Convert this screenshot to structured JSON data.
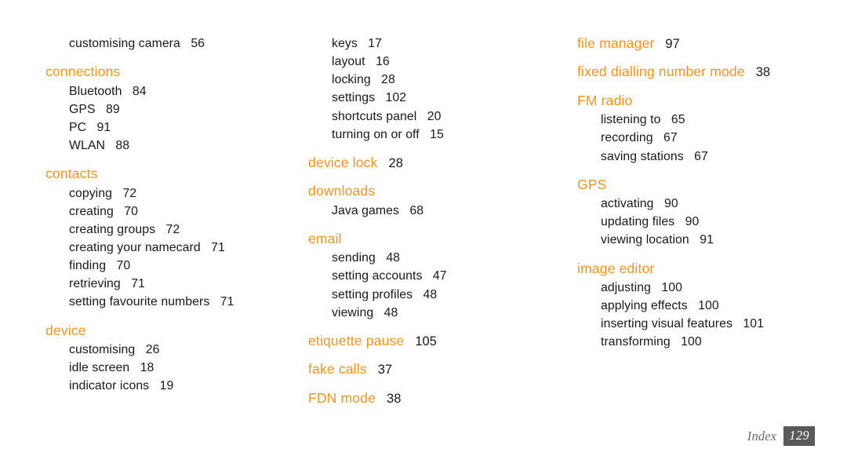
{
  "document": {
    "type": "index-page",
    "footer": {
      "label": "Index",
      "page_number": "129"
    },
    "colors": {
      "heading": "#F7941E",
      "body_text": "#181818",
      "page_number_badge_background": "#595959",
      "page_number_badge_text": "#FFFFFF",
      "footer_label": "#6B6B6B",
      "background": "#FFFFFF"
    }
  },
  "columns": [
    {
      "id": "column-1",
      "entries": [
        {
          "level": "sub",
          "label": "customising camera",
          "page": "56"
        },
        {
          "level": "head",
          "label": "connections",
          "page": ""
        },
        {
          "level": "sub",
          "label": "Bluetooth",
          "page": "84"
        },
        {
          "level": "sub",
          "label": "GPS",
          "page": "89"
        },
        {
          "level": "sub",
          "label": "PC",
          "page": "91"
        },
        {
          "level": "sub",
          "label": "WLAN",
          "page": "88"
        },
        {
          "level": "head",
          "label": "contacts",
          "page": ""
        },
        {
          "level": "sub",
          "label": "copying",
          "page": "72"
        },
        {
          "level": "sub",
          "label": "creating",
          "page": "70"
        },
        {
          "level": "sub",
          "label": "creating groups",
          "page": "72"
        },
        {
          "level": "sub",
          "label": "creating your namecard",
          "page": "71"
        },
        {
          "level": "sub",
          "label": "finding",
          "page": "70"
        },
        {
          "level": "sub",
          "label": "retrieving",
          "page": "71"
        },
        {
          "level": "sub",
          "label": "setting favourite numbers",
          "page": "71"
        },
        {
          "level": "head",
          "label": "device",
          "page": ""
        },
        {
          "level": "sub",
          "label": "customising",
          "page": "26"
        },
        {
          "level": "sub",
          "label": "idle screen",
          "page": "18"
        },
        {
          "level": "sub",
          "label": "indicator icons",
          "page": "19"
        }
      ]
    },
    {
      "id": "column-2",
      "entries": [
        {
          "level": "sub",
          "label": "keys",
          "page": "17"
        },
        {
          "level": "sub",
          "label": "layout",
          "page": "16"
        },
        {
          "level": "sub",
          "label": "locking",
          "page": "28"
        },
        {
          "level": "sub",
          "label": "settings",
          "page": "102"
        },
        {
          "level": "sub",
          "label": "shortcuts panel",
          "page": "20"
        },
        {
          "level": "sub",
          "label": "turning on or off",
          "page": "15"
        },
        {
          "level": "head",
          "label": "device lock",
          "page": "28"
        },
        {
          "level": "head",
          "label": "downloads",
          "page": ""
        },
        {
          "level": "sub",
          "label": "Java games",
          "page": "68"
        },
        {
          "level": "head",
          "label": "email",
          "page": ""
        },
        {
          "level": "sub",
          "label": "sending",
          "page": "48"
        },
        {
          "level": "sub",
          "label": "setting accounts",
          "page": "47"
        },
        {
          "level": "sub",
          "label": "setting profiles",
          "page": "48"
        },
        {
          "level": "sub",
          "label": "viewing",
          "page": "48"
        },
        {
          "level": "head",
          "label": "etiquette pause",
          "page": "105"
        },
        {
          "level": "head",
          "label": "fake calls",
          "page": "37"
        },
        {
          "level": "head",
          "label": "FDN mode",
          "page": "38"
        }
      ]
    },
    {
      "id": "column-3",
      "entries": [
        {
          "level": "head",
          "label": "file manager",
          "page": "97"
        },
        {
          "level": "head",
          "label": "fixed dialling number mode",
          "page": "38"
        },
        {
          "level": "head",
          "label": "FM radio",
          "page": ""
        },
        {
          "level": "sub",
          "label": "listening to",
          "page": "65"
        },
        {
          "level": "sub",
          "label": "recording",
          "page": "67"
        },
        {
          "level": "sub",
          "label": "saving stations",
          "page": "67"
        },
        {
          "level": "head",
          "label": "GPS",
          "page": ""
        },
        {
          "level": "sub",
          "label": "activating",
          "page": "90"
        },
        {
          "level": "sub",
          "label": "updating files",
          "page": "90"
        },
        {
          "level": "sub",
          "label": "viewing location",
          "page": "91"
        },
        {
          "level": "head",
          "label": "image editor",
          "page": ""
        },
        {
          "level": "sub",
          "label": "adjusting",
          "page": "100"
        },
        {
          "level": "sub",
          "label": "applying effects",
          "page": "100"
        },
        {
          "level": "sub",
          "label": "inserting visual features",
          "page": "101"
        },
        {
          "level": "sub",
          "label": "transforming",
          "page": "100"
        }
      ]
    }
  ]
}
